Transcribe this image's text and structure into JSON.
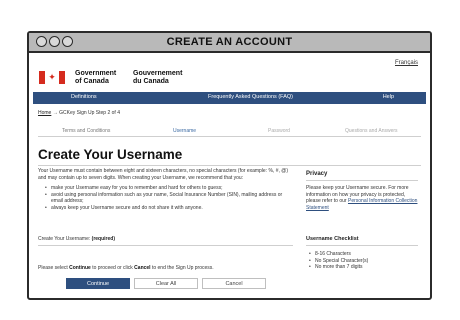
{
  "window": {
    "title": "CREATE AN ACCOUNT"
  },
  "header": {
    "language_link": "Français",
    "gov_en_line1": "Government",
    "gov_en_line2": "of Canada",
    "gov_fr_line1": "Gouvernement",
    "gov_fr_line2": "du Canada"
  },
  "nav": {
    "items": [
      "Definitions",
      "Frequently Asked Questions (FAQ)",
      "Help"
    ]
  },
  "breadcrumb": {
    "home": "Home",
    "current": "→ GCKey Sign Up Step 2 of 4"
  },
  "steps": [
    "Terms and Conditions",
    "Username",
    "Password",
    "Questions and Answers"
  ],
  "page": {
    "title": "Create Your Username",
    "intro": "Your Username must contain between eight and sixteen characters, no special characters (for example: %, #, @) and may contain up to seven digits. When creating your Username, we recommend that you:",
    "tips": [
      "make your Username easy for you to remember and hard for others to guess;",
      "avoid using personal information such as your name, Social Insurance Number (SIN), mailing address or email address;",
      "always keep your Username secure and do not share it with anyone."
    ],
    "username_label": "Create Your Username:",
    "username_required": "(required)",
    "proceed_prefix": "Please select",
    "proceed_continue": "Continue",
    "proceed_mid": "to proceed or click",
    "proceed_cancel": "Cancel",
    "proceed_suffix": "to end the Sign Up process."
  },
  "privacy": {
    "heading": "Privacy",
    "text": "Please keep your Username secure. For more information on how your privacy is protected, please refer to our",
    "link": "Personal Information Collection Statement"
  },
  "checklist": {
    "heading": "Username Checklist",
    "items": [
      "8-16 Characters",
      "No Special Character(s)",
      "No more than 7 digits"
    ]
  },
  "buttons": {
    "continue": "Continue",
    "clear": "Clear All",
    "cancel": "Cancel"
  },
  "colors": {
    "brand_blue": "#2e4f7f",
    "flag_red": "#d52b1e"
  }
}
